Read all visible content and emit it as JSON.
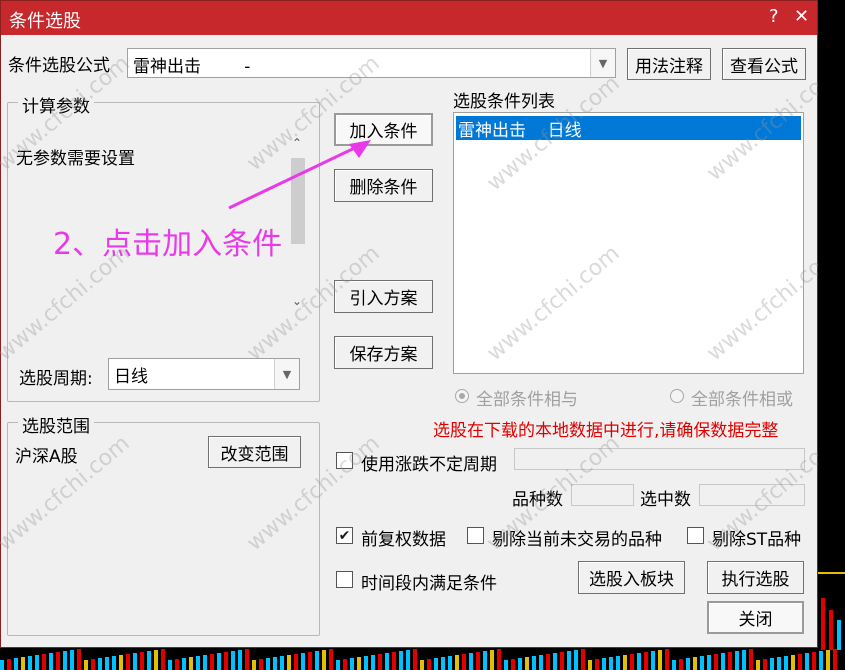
{
  "window": {
    "title": "条件选股",
    "help_label": "?",
    "close_label": "✕"
  },
  "formula": {
    "label": "条件选股公式",
    "value": "雷神出击        -",
    "usage_button": "用法注释",
    "view_button": "查看公式"
  },
  "params": {
    "group_label": "计算参数",
    "message": "无参数需要设置"
  },
  "period": {
    "label": "选股周期:",
    "value": "日线"
  },
  "range": {
    "group_label": "选股范围",
    "value": "沪深A股",
    "change_button": "改变范围"
  },
  "condition_buttons": {
    "add": "加入条件",
    "delete": "删除条件",
    "import": "引入方案",
    "save": "保存方案"
  },
  "condition_list": {
    "label": "选股条件列表",
    "items": [
      "雷神出击    日线"
    ]
  },
  "logic": {
    "and_label": "全部条件相与",
    "or_label": "全部条件相或",
    "selected": "and"
  },
  "warning": "选股在下载的本地数据中进行,请确保数据完整",
  "options": {
    "uncertain_period": "使用涨跌不定周期",
    "variety_count_label": "品种数",
    "selected_count_label": "选中数",
    "pre_adjust": "前复权数据",
    "pre_adjust_checked": true,
    "exclude_untraded": "剔除当前未交易的品种",
    "exclude_st": "剔除ST品种",
    "time_segment": "时间段内满足条件"
  },
  "actions": {
    "to_block": "选股入板块",
    "execute": "执行选股",
    "close": "关闭"
  },
  "annotation": "2、点击加入条件",
  "watermark": "www.cfchi.com"
}
